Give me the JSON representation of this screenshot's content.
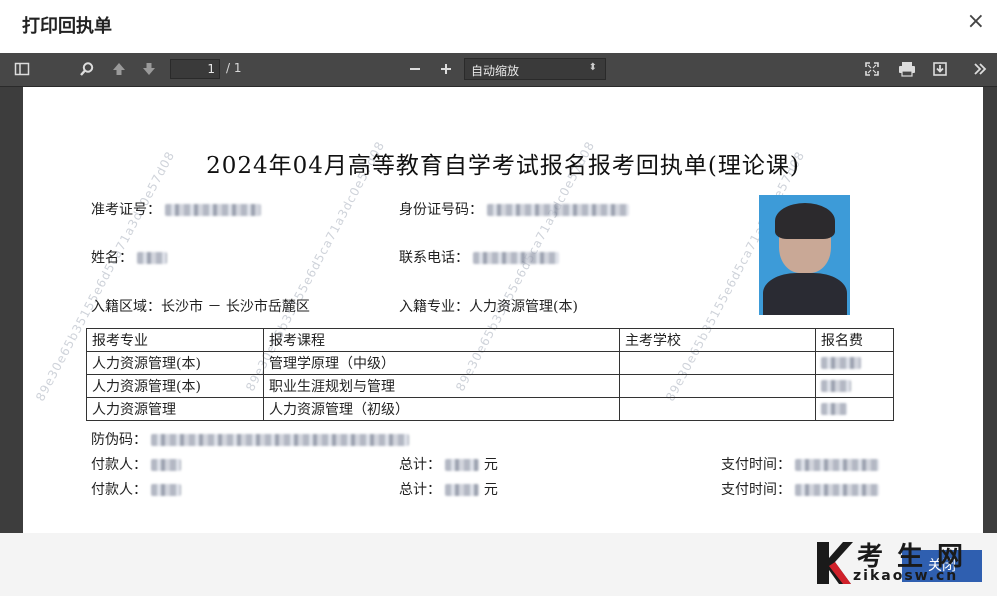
{
  "dialog": {
    "title": "打印回执单",
    "close_glyph": "×"
  },
  "toolbar": {
    "page_value": "1",
    "page_count": "/ 1",
    "zoom_label": "自动缩放",
    "icons": [
      "sidebar-toggle-icon",
      "search-icon",
      "previous-page-icon",
      "next-page-icon",
      "zoom-out-icon",
      "zoom-in-icon",
      "fullscreen-icon",
      "print-icon",
      "download-icon",
      "more-tools-icon"
    ]
  },
  "document": {
    "title": "2024年04月高等教育自学考试报名报考回执单(理论课)",
    "fields": {
      "exam_id_label": "准考证号：",
      "id_card_label": "身份证号码：",
      "name_label": "姓名：",
      "phone_label": "联系电话：",
      "region_label": "入籍区域：",
      "region_value": "长沙市 － 长沙市岳麓区",
      "major_label": "入籍专业：",
      "major_value": "人力资源管理(本)",
      "antifake_label": "防伪码：",
      "payer_label": "付款人：",
      "total_label": "总计：",
      "total_unit": "元",
      "paytime_label": "支付时间："
    },
    "table": {
      "headers": [
        "报考专业",
        "报考课程",
        "主考学校",
        "报名费"
      ],
      "rows": [
        [
          "人力资源管理(本)",
          "管理学原理（中级）",
          "",
          ""
        ],
        [
          "人力资源管理(本)",
          "职业生涯规划与管理",
          "",
          ""
        ],
        [
          "人力资源管理",
          "人力资源管理（初级）",
          "",
          ""
        ]
      ]
    },
    "watermark": "89e30e65b35155e6d5ca71a3dc0e57d08"
  },
  "footer": {
    "close_label": "关闭",
    "logo_text": "考生网",
    "logo_url": "zikaosw.cn"
  }
}
